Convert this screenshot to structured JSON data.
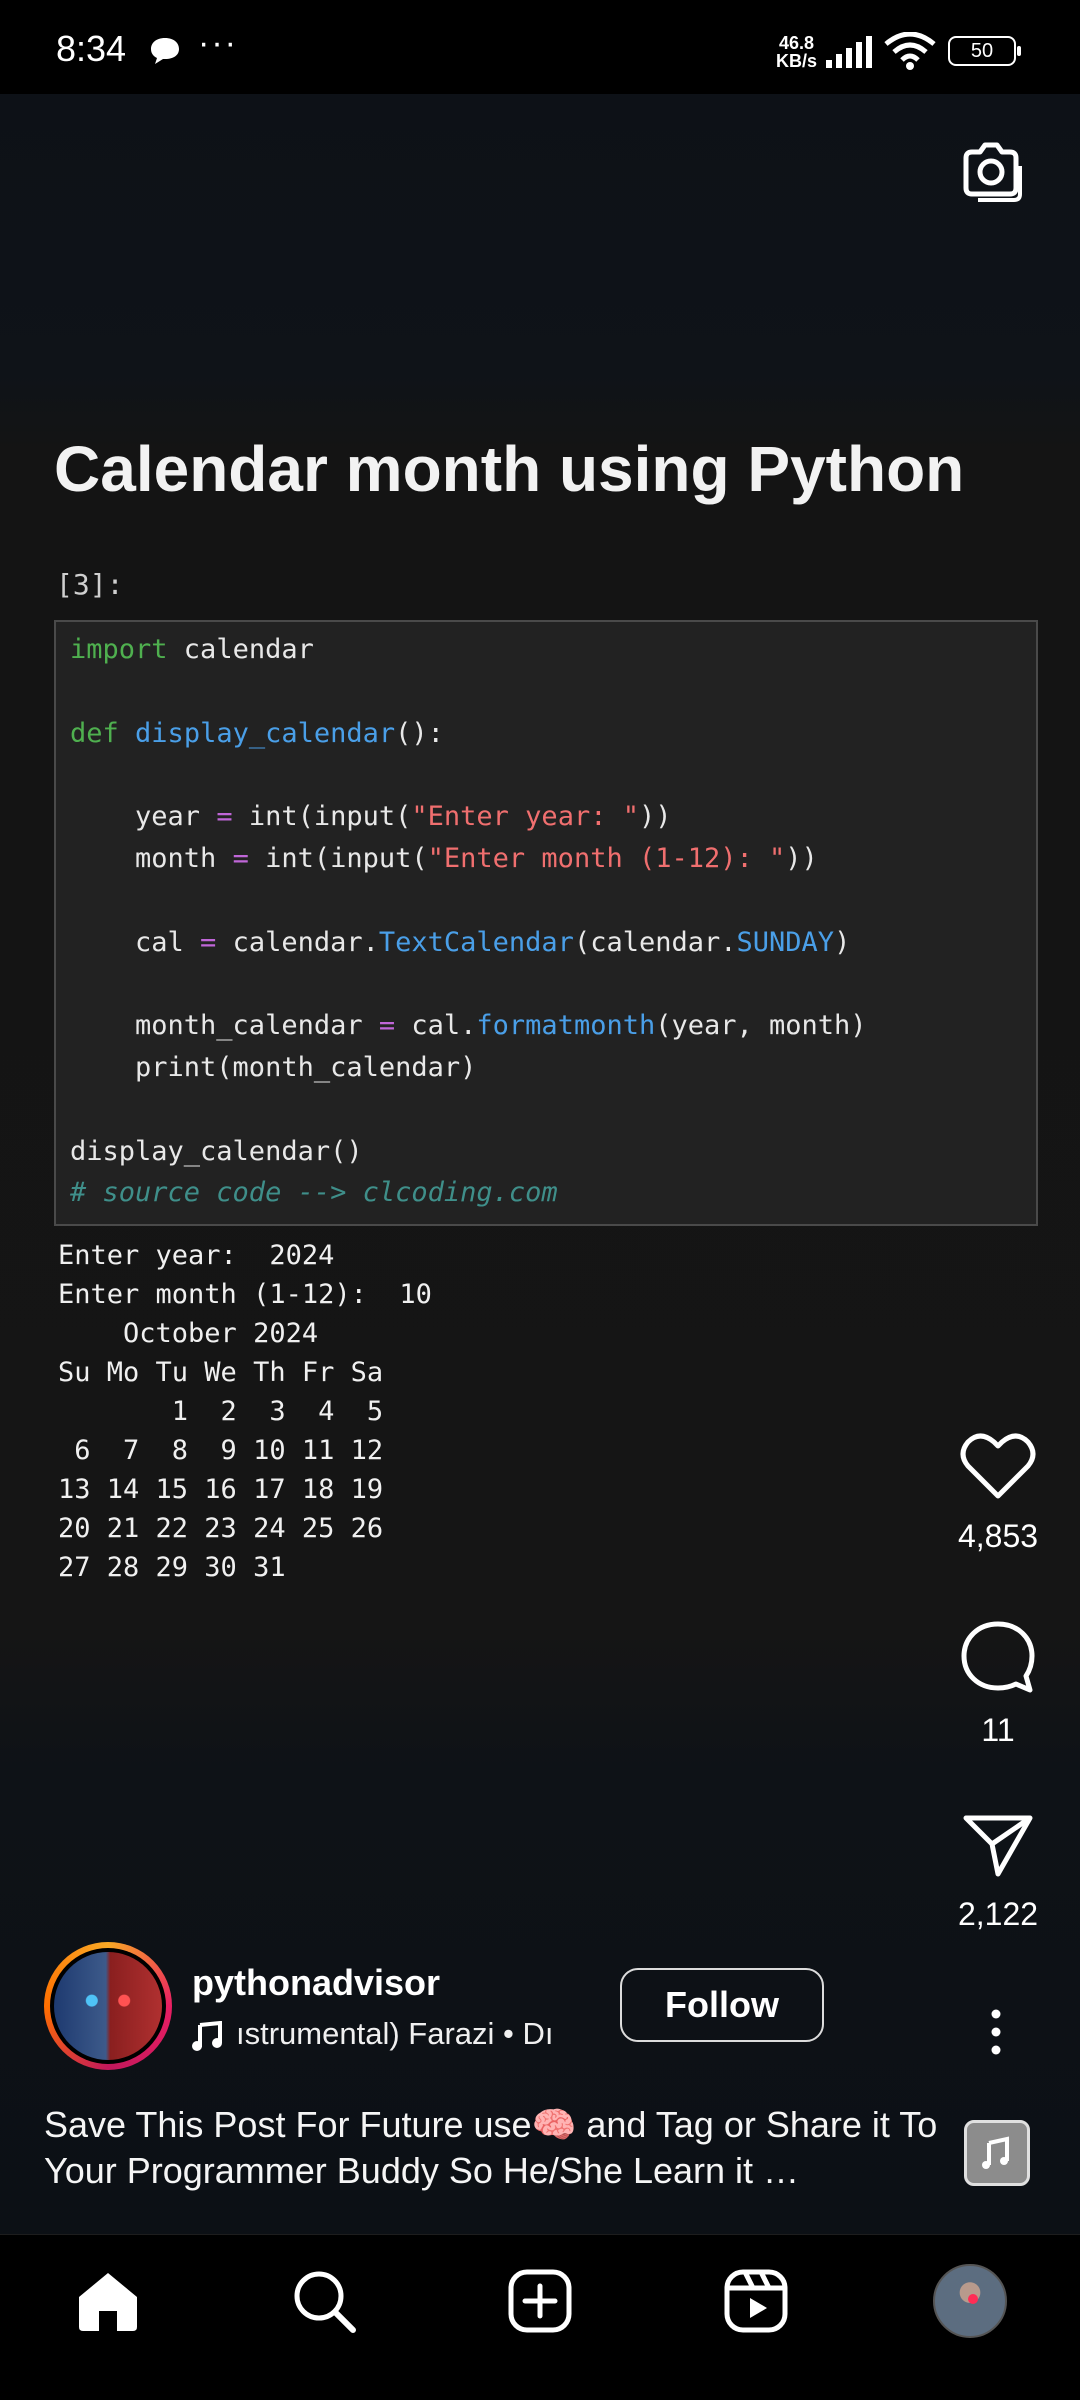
{
  "status_bar": {
    "time": "8:34",
    "dots": "···",
    "net_speed_value": "46.8",
    "net_speed_unit": "KB/s",
    "battery": "50"
  },
  "post": {
    "title": "Calendar month using Python",
    "cell_label": "[3]:",
    "code_lines": [
      "import calendar",
      "",
      "def display_calendar():",
      "",
      "    year = int(input(\"Enter year: \"))",
      "    month = int(input(\"Enter month (1-12): \"))",
      "",
      "    cal = calendar.TextCalendar(calendar.SUNDAY)",
      "",
      "    month_calendar = cal.formatmonth(year, month)",
      "    print(month_calendar)",
      "",
      "display_calendar()",
      "# source code --> clcoding.com"
    ],
    "output_lines": [
      "Enter year:  2024",
      "Enter month (1-12):  10",
      "    October 2024",
      "Su Mo Tu We Th Fr Sa",
      "       1  2  3  4  5",
      " 6  7  8  9 10 11 12",
      "13 14 15 16 17 18 19",
      "20 21 22 23 24 25 26",
      "27 28 29 30 31"
    ]
  },
  "actions": {
    "likes": "4,853",
    "comments": "11",
    "shares": "2,122"
  },
  "account": {
    "username": "pythonadvisor",
    "music_text": "ıstrumental)    Farazi • Dı",
    "follow_label": "Follow"
  },
  "caption": "Save This Post For Future use🧠 and Tag or Share it To Your Programmer Buddy So He/She Learn it …",
  "nav": [
    "home",
    "search",
    "create",
    "reels",
    "profile"
  ],
  "colors": {
    "keyword": "#4fb04f",
    "function": "#4a9fe8",
    "operator": "#c066d8",
    "string": "#f06f6f",
    "comment": "#3f8f8a",
    "notification_dot": "#ff2d55"
  }
}
